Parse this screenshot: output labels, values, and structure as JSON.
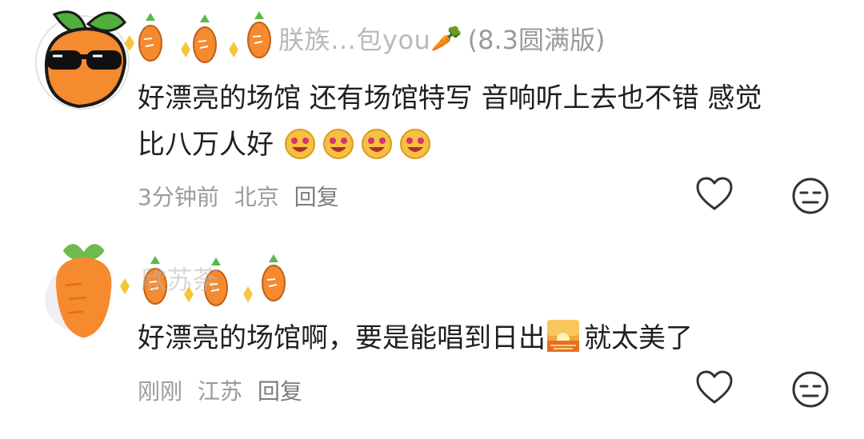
{
  "comments": [
    {
      "username": "朕族…包you",
      "username_suffix": "🥕",
      "user_version": "(8.3圆满版)",
      "text_line1": "好漂亮的场馆 还有场馆特写 音响听上去也不错 感觉",
      "text_line2": "比八万人好",
      "time": "3分钟前",
      "location": "北京",
      "reply_label": "回复"
    },
    {
      "username": "欣苏荼",
      "user_version": "",
      "text_before": "好漂亮的场馆啊，要是能唱到日出",
      "text_after": "就太美了",
      "time": "刚刚",
      "location": "江苏",
      "reply_label": "回复"
    }
  ],
  "colors": {
    "carrot_orange": "#f58a2f",
    "carrot_leaf": "#58b947",
    "meta_gray": "#9b9b9b",
    "username_gray": "#b9b9b9"
  },
  "icons": {
    "like": "heart-outline-icon",
    "dislike": "neutral-face-icon",
    "sunrise": "sunrise-emoji-icon",
    "laughing": "laughing-face-emoji-icon"
  }
}
